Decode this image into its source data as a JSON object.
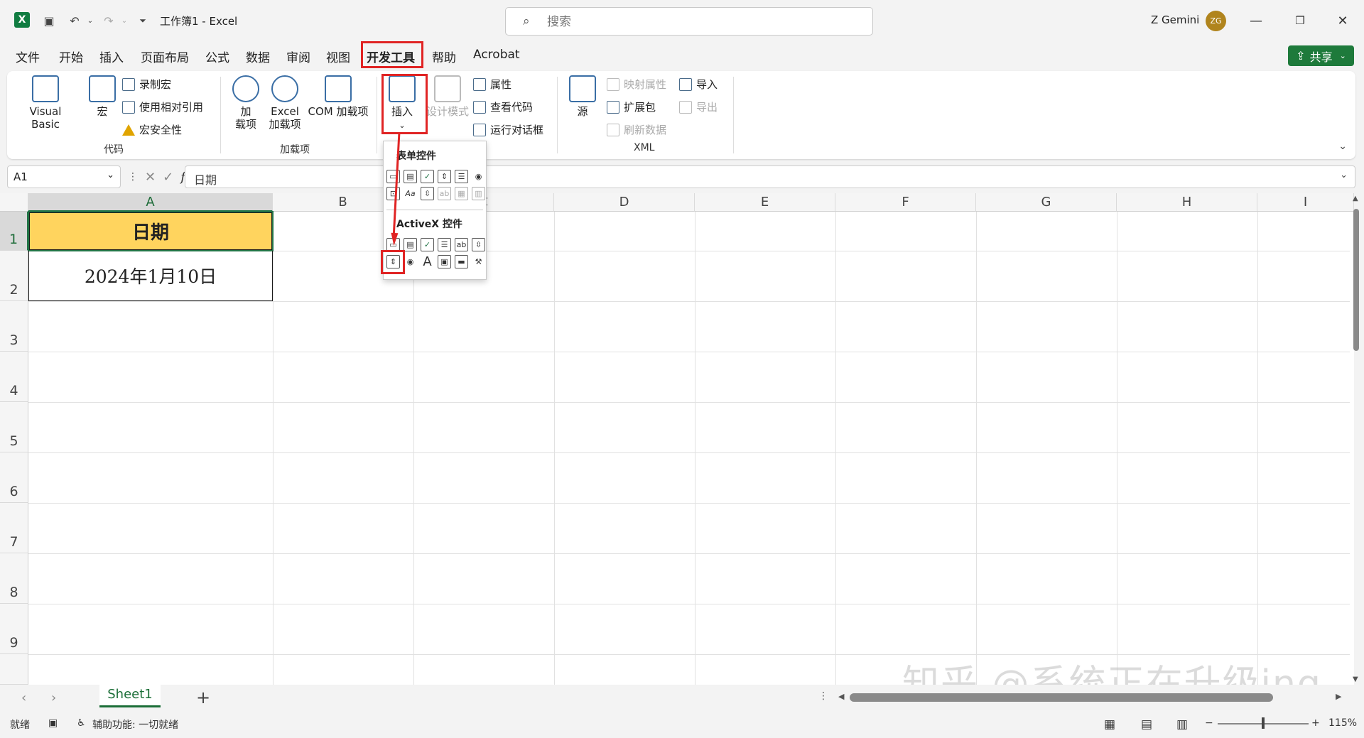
{
  "title_bar": {
    "doc_title": "工作簿1  -  Excel",
    "search_placeholder": "搜索",
    "user_name": "Z Gemini",
    "user_initials": "ZG",
    "logo_letter": "X"
  },
  "menu_tabs": [
    {
      "label": "文件"
    },
    {
      "label": "开始"
    },
    {
      "label": "插入"
    },
    {
      "label": "页面布局"
    },
    {
      "label": "公式"
    },
    {
      "label": "数据"
    },
    {
      "label": "审阅"
    },
    {
      "label": "视图"
    },
    {
      "label": "开发工具",
      "active": true
    },
    {
      "label": "帮助"
    },
    {
      "label": "Acrobat"
    }
  ],
  "share_label": "共享",
  "ribbon": {
    "code": {
      "label": "代码",
      "visual_basic": "Visual Basic",
      "macros": "宏",
      "record_macro": "录制宏",
      "relative_refs": "使用相对引用",
      "macro_security": "宏安全性"
    },
    "addins": {
      "label": "加载项",
      "addins_line1": "加",
      "addins_line2": "载项",
      "excel_addins_line1": "Excel",
      "excel_addins_line2": "加载项",
      "com_addins": "COM 加载项"
    },
    "controls": {
      "insert": "插入",
      "design_mode": "设计模式",
      "properties": "属性",
      "view_code": "查看代码",
      "run_dialog": "运行对话框"
    },
    "xml": {
      "label": "XML",
      "source": "源",
      "map_properties": "映射属性",
      "expansion_packs": "扩展包",
      "refresh_data": "刷新数据",
      "import": "导入",
      "export": "导出"
    }
  },
  "insert_dropdown": {
    "form_controls_title": "表单控件",
    "activex_title": "ActiveX 控件"
  },
  "formula_bar": {
    "name_box": "A1",
    "fx": "fx",
    "formula": "日期"
  },
  "columns": [
    "A",
    "B",
    "C",
    "D",
    "E",
    "F",
    "G",
    "H",
    "I"
  ],
  "rows": [
    "1",
    "2",
    "3",
    "4",
    "5",
    "6",
    "7",
    "8",
    "9"
  ],
  "cells": {
    "A1": "日期",
    "A2": "2024年1月10日"
  },
  "sheet_tabs": [
    {
      "label": "Sheet1",
      "active": true
    }
  ],
  "status_bar": {
    "ready": "就绪",
    "accessibility": "辅助功能: 一切就绪",
    "zoom": "115%"
  },
  "watermark": "知乎 @系统正在升级ing",
  "colors": {
    "header_fill": "#ffd45e",
    "excel_green": "#217346",
    "highlight_red": "#e02424"
  }
}
